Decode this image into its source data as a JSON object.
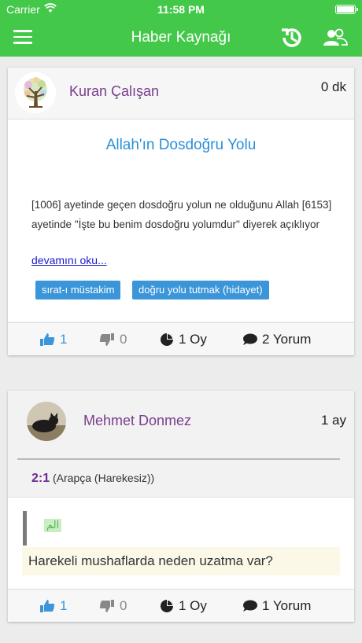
{
  "status_bar": {
    "carrier": "Carrier",
    "time": "11:58 PM"
  },
  "nav": {
    "title": "Haber Kaynağı"
  },
  "posts": [
    {
      "author": "Kuran Çalışan",
      "age": "0 dk",
      "title": "Allah'ın Dosdoğru Yolu",
      "text": "[1006] ayetinde geçen dosdoğru yolun ne olduğunu Allah [6153] ayetinde  \"İşte bu benim dosdoğru yolumdur\" diyerek açıklıyor",
      "read_more": "devamını oku...",
      "tags": [
        "sırat-ı müstakim",
        "doğru yolu tutmak (hidayet)"
      ],
      "likes": "1",
      "dislikes": "0",
      "votes": "1 Oy",
      "comments": "2 Yorum"
    },
    {
      "author": "Mehmet Donmez",
      "age": "1 ay",
      "verse_number": "2:1",
      "verse_label": "(Arapça (Harekesiz))",
      "arabic": "الم",
      "question": "Harekeli mushaflarda neden uzatma var?",
      "likes": "1",
      "dislikes": "0",
      "votes": "1 Oy",
      "comments": "1 Yorum"
    }
  ],
  "colors": {
    "header_green": "#43c84a",
    "accent_blue": "#3b95d9",
    "author_purple": "#7a3d8f"
  }
}
